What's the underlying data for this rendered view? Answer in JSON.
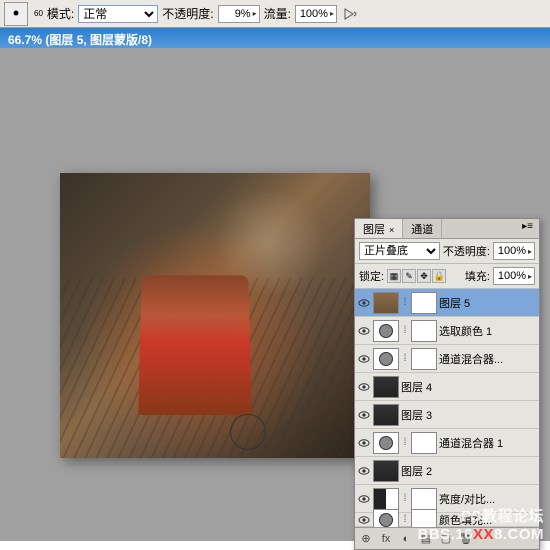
{
  "options": {
    "brush_size": "60",
    "mode_label": "模式:",
    "mode_value": "正常",
    "opacity_label": "不透明度:",
    "opacity_value": "9%",
    "flow_label": "流量:",
    "flow_value": "100%"
  },
  "document": {
    "title": "66.7%  (图层 5, 图层蒙版/8)"
  },
  "panel": {
    "tabs": {
      "layers": "图层",
      "channels": "通道"
    },
    "blend": {
      "mode": "正片叠底",
      "opacity_label": "不透明度:",
      "opacity_value": "100%"
    },
    "lock": {
      "label": "锁定:",
      "fill_label": "填充:",
      "fill_value": "100%"
    },
    "layers": [
      {
        "name": "图层 5",
        "selected": true,
        "thumb": "warm",
        "mask": true
      },
      {
        "name": "选取颜色 1",
        "selected": false,
        "thumb": "adj",
        "mask": true
      },
      {
        "name": "通道混合器...",
        "selected": false,
        "thumb": "adj",
        "mask": true,
        "adjtrain": true
      },
      {
        "name": "图层 4",
        "selected": false,
        "thumb": "dark",
        "mask": false
      },
      {
        "name": "图层 3",
        "selected": false,
        "thumb": "dark",
        "mask": false
      },
      {
        "name": "通道混合器 1",
        "selected": false,
        "thumb": "adj",
        "mask": true
      },
      {
        "name": "图层 2",
        "selected": false,
        "thumb": "dark",
        "mask": false
      },
      {
        "name": "亮度/对比...",
        "selected": false,
        "thumb": "half",
        "mask": true
      },
      {
        "name": "颜色填充...",
        "selected": false,
        "thumb": "adj",
        "mask": true,
        "partial": true
      }
    ],
    "footer_icons": [
      "⊕",
      "fx",
      "◐",
      "▤",
      "▢",
      "🗑"
    ]
  },
  "watermark": {
    "line1": "PS教程论坛",
    "line2_prefix": "BBS.16",
    "line2_mid": "XX",
    "line2_suffix": "8.COM"
  }
}
